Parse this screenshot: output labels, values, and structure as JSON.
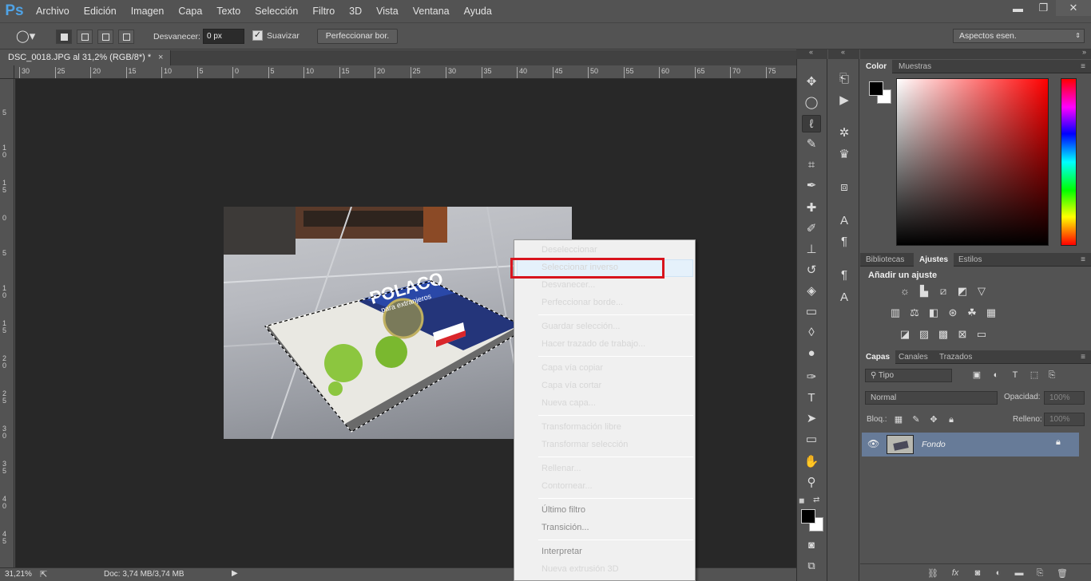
{
  "app": {
    "logo": "Ps"
  },
  "menu": [
    "Archivo",
    "Edición",
    "Imagen",
    "Capa",
    "Texto",
    "Selección",
    "Filtro",
    "3D",
    "Vista",
    "Ventana",
    "Ayuda"
  ],
  "window_controls": {
    "minimize": "▬",
    "restore": "❐",
    "close": "✕"
  },
  "options": {
    "fade_label": "Desvanecer:",
    "fade_value": "0 px",
    "smooth_label": "Suavizar",
    "smooth_checked": true,
    "refine_label": "Perfeccionar bor.",
    "workspace": "Aspectos esen."
  },
  "document": {
    "tab_title": "DSC_0018.JPG al 31,2% (RGB/8*) *",
    "close": "×"
  },
  "ruler": {
    "h": [
      "30",
      "25",
      "20",
      "15",
      "10",
      "5",
      "0",
      "5",
      "10",
      "15",
      "20",
      "25",
      "30",
      "35",
      "40",
      "45",
      "50",
      "55",
      "60",
      "65",
      "70",
      "75",
      "80"
    ],
    "v": [
      "5",
      "10",
      "15",
      "0",
      "5",
      "10",
      "15",
      "20",
      "25",
      "30",
      "35",
      "40",
      "45"
    ]
  },
  "status": {
    "zoom": "31,21%",
    "doc": "Doc: 3,74 MB/3,74 MB"
  },
  "context_menu": [
    {
      "label": "Deseleccionar",
      "disabled": false
    },
    {
      "label": "Seleccionar inverso",
      "disabled": false,
      "hover": true
    },
    {
      "label": "Desvanecer...",
      "disabled": false
    },
    {
      "label": "Perfeccionar borde...",
      "disabled": false
    },
    {
      "label": "Guardar selección...",
      "disabled": false
    },
    {
      "label": "Hacer trazado de trabajo...",
      "disabled": false
    },
    {
      "label": "Capa vía copiar",
      "disabled": false
    },
    {
      "label": "Capa vía cortar",
      "disabled": false
    },
    {
      "label": "Nueva capa...",
      "disabled": false
    },
    {
      "label": "Transformación libre",
      "disabled": false
    },
    {
      "label": "Transformar selección",
      "disabled": false
    },
    {
      "label": "Rellenar...",
      "disabled": false
    },
    {
      "label": "Contornear...",
      "disabled": false
    },
    {
      "label": "Último filtro",
      "disabled": true
    },
    {
      "label": "Transición...",
      "disabled": true
    },
    {
      "label": "Interpretar",
      "disabled": true
    },
    {
      "label": "Nueva extrusión 3D",
      "disabled": false
    }
  ],
  "book": {
    "title": "POLACO",
    "subtitle": "para extranjeros"
  },
  "panels": {
    "color_tabs": [
      "Color",
      "Muestras"
    ],
    "adjust_tabs": [
      "Bibliotecas",
      "Ajustes",
      "Estilos"
    ],
    "adjust_title": "Añadir un ajuste",
    "layers_tabs": [
      "Capas",
      "Canales",
      "Trazados"
    ],
    "layer_filter": "Tipo",
    "blend_mode": "Normal",
    "opacity_label": "Opacidad:",
    "opacity_value": "100%",
    "lock_label": "Bloq.:",
    "fill_label": "Relleno:",
    "fill_value": "100%",
    "layer_name": "Fondo"
  },
  "colors": {
    "foreground": "#000000",
    "background": "#ffffff",
    "highlight": "#d8141d",
    "selected_layer": "#677b98"
  }
}
